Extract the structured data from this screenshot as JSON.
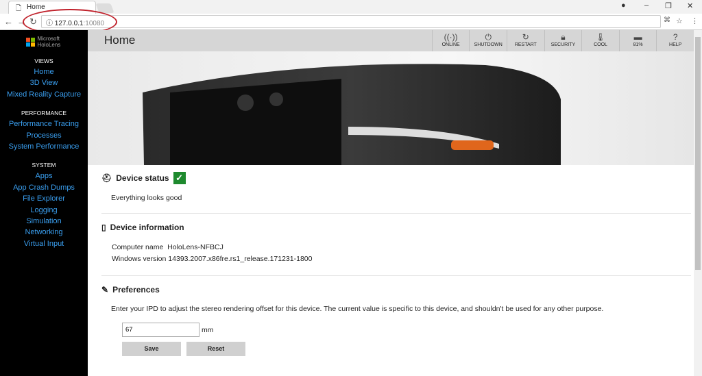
{
  "browser": {
    "tab_title": "Home",
    "url_host": "127.0.0.1",
    "url_port": ":10080"
  },
  "sidebar": {
    "logo": "Microsoft HoloLens",
    "sections": [
      {
        "title": "VIEWS",
        "items": [
          "Home",
          "3D View",
          "Mixed Reality Capture"
        ]
      },
      {
        "title": "PERFORMANCE",
        "items": [
          "Performance Tracing",
          "Processes",
          "System Performance"
        ]
      },
      {
        "title": "SYSTEM",
        "items": [
          "Apps",
          "App Crash Dumps",
          "File Explorer",
          "Logging",
          "Simulation",
          "Networking",
          "Virtual Input"
        ]
      }
    ]
  },
  "header": {
    "title": "Home",
    "tools": [
      {
        "label": "ONLINE",
        "icon": "antenna-icon",
        "glyph": "((·))"
      },
      {
        "label": "SHUTDOWN",
        "icon": "power-icon",
        "glyph": "⏻"
      },
      {
        "label": "RESTART",
        "icon": "restart-icon",
        "glyph": "↻"
      },
      {
        "label": "SECURITY",
        "icon": "lock-icon",
        "glyph": "🔒︎"
      },
      {
        "label": "COOL",
        "icon": "thermometer-icon",
        "glyph": "🌡︎"
      },
      {
        "label": "81%",
        "icon": "battery-icon",
        "glyph": "▬"
      },
      {
        "label": "HELP",
        "icon": "help-icon",
        "glyph": "?"
      }
    ]
  },
  "status": {
    "heading": "Device status",
    "text": "Everything looks good",
    "color": "#1e8a2e"
  },
  "info": {
    "heading": "Device information",
    "computer_label": "Computer name",
    "computer_value": "HoloLens-NFBCJ",
    "windows_label": "Windows version",
    "windows_value": "14393.2007.x86fre.rs1_release.171231-1800"
  },
  "prefs": {
    "heading": "Preferences",
    "desc": "Enter your IPD to adjust the stereo rendering offset for this device. The current value is specific to this device, and shouldn't be used for any other purpose.",
    "ipd_value": "67",
    "unit": "mm",
    "save": "Save",
    "reset": "Reset"
  }
}
